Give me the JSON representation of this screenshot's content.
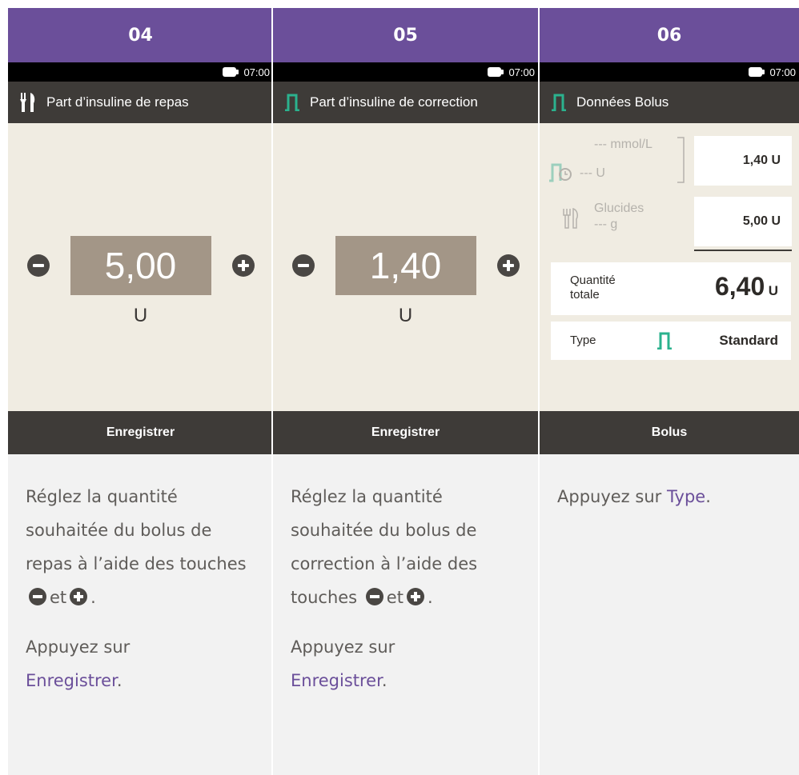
{
  "status": {
    "time": "07:00"
  },
  "steps": [
    {
      "number": "04",
      "screen_title": "Part d’insuline de repas",
      "title_icon": "fork-knife-icon",
      "value": "5,00",
      "unit": "U",
      "action": "Enregistrer",
      "desc_p1_a": "Réglez la quantité souhaitée du bolus de repas à l’aide des touches",
      "desc_p1_b": "et",
      "desc_p2_a": "Appuyez sur",
      "desc_p2_link": "Enregistrer",
      "desc_p2_end": "."
    },
    {
      "number": "05",
      "screen_title": "Part d’insuline de correction",
      "title_icon": "standard-bolus-icon",
      "value": "1,40",
      "unit": "U",
      "action": "Enregistrer",
      "desc_p1_a": "Réglez la quantité souhaitée du bolus de correction à l’aide des touches",
      "desc_p1_b": "et",
      "desc_p2_a": "Appuyez sur",
      "desc_p2_link": "Enregistrer",
      "desc_p2_end": "."
    },
    {
      "number": "06",
      "screen_title": "Données Bolus",
      "title_icon": "standard-bolus-icon",
      "glucose_label": "--- mmol/L",
      "correction_label": "--- U",
      "correction_value": "1,40 U",
      "carbs_label": "Glucides",
      "carbs_unit_label": "--- g",
      "carbs_value": "5,00 U",
      "total_label_1": "Quantité",
      "total_label_2": "totale",
      "total_value": "6,40",
      "total_unit": "U",
      "type_label": "Type",
      "type_value": "Standard",
      "action": "Bolus",
      "desc_p1_a": "Appuyez sur",
      "desc_p1_link": "Type",
      "desc_p1_end": "."
    }
  ],
  "colors": {
    "accent": "#6b4f9a",
    "bolus_green": "#2bb28e",
    "dark": "#3e3b38",
    "value_box": "#a39687"
  }
}
